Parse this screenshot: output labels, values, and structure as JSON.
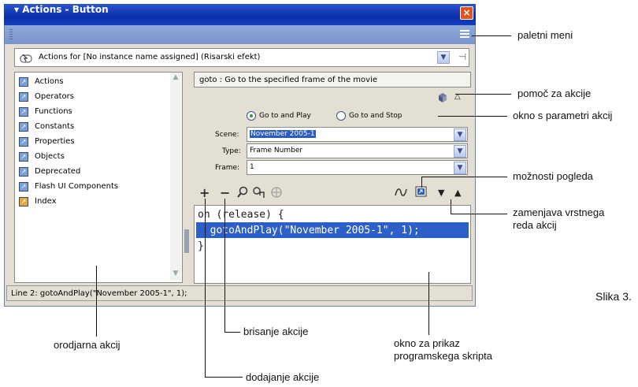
{
  "window": {
    "panel_title": "▾ Actions - Button",
    "close_glyph": "×"
  },
  "actions_for": {
    "label": "Actions for [No instance name assigned] (Risarski efekt)"
  },
  "toolbox": {
    "items": [
      {
        "label": "Actions",
        "icon": "book-icon"
      },
      {
        "label": "Operators",
        "icon": "book-icon"
      },
      {
        "label": "Functions",
        "icon": "book-icon"
      },
      {
        "label": "Constants",
        "icon": "book-icon"
      },
      {
        "label": "Properties",
        "icon": "book-icon"
      },
      {
        "label": "Objects",
        "icon": "book-icon"
      },
      {
        "label": "Deprecated",
        "icon": "book-icon"
      },
      {
        "label": "Flash UI Components",
        "icon": "book-icon"
      },
      {
        "label": "Index",
        "icon": "index-icon"
      }
    ]
  },
  "help": {
    "text": "goto : Go to the specified frame of the movie"
  },
  "params": {
    "radio_play": "Go to and Play",
    "radio_stop": "Go to and Stop",
    "scene_label": "Scene:",
    "scene_value": "November 2005-1",
    "type_label": "Type:",
    "type_value": "Frame Number",
    "frame_label": "Frame:",
    "frame_value": "1"
  },
  "toolbar": {
    "add": "+",
    "remove": "−"
  },
  "script": {
    "line1": "on (release) {",
    "line2": "  gotoAndPlay(\"November 2005-1\", 1);",
    "line3": "}"
  },
  "status": {
    "text": "Line 2: gotoAndPlay(\"November 2005-1\", 1);"
  },
  "annotations": {
    "paletni_meni": "paletni meni",
    "pomoc": "pomoč za akcije",
    "okno_parametri": "okno s parametri akcij",
    "moznosti": "možnosti pogleda",
    "zamenjava_1": "zamenjava vrstnega",
    "zamenjava_2": "reda akcij",
    "slika": "Slika 3.",
    "orodjarna": "orodjarna akcij",
    "brisanje": "brisanje akcije",
    "dodajanje": "dodajanje akcije",
    "okno_prikaz_1": "okno za prikaz",
    "okno_prikaz_2": "programskega skripta"
  },
  "colors": {
    "titlebar": "#0a2ea8",
    "panel_header": "#8ea9da",
    "highlight": "#2c5fc8",
    "window_bg": "#e3dfd3"
  }
}
